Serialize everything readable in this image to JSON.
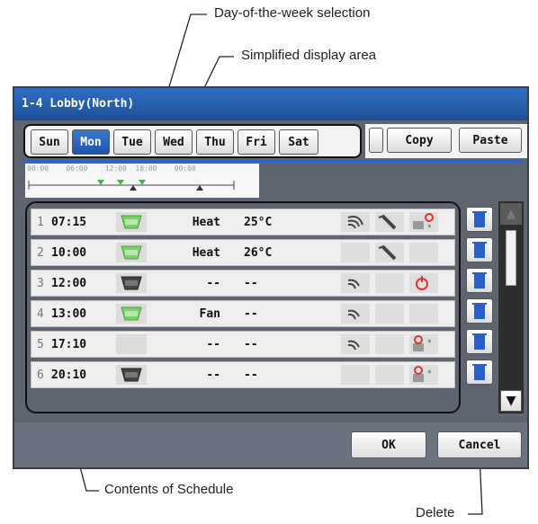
{
  "annotations": {
    "day_selection": "Day-of-the-week selection",
    "simplified_area": "Simplified display area",
    "contents": "Contents of Schedule",
    "delete": "Delete"
  },
  "window": {
    "title": "1-4 Lobby(North)"
  },
  "days": [
    "Sun",
    "Mon",
    "Tue",
    "Wed",
    "Thu",
    "Fri",
    "Sat"
  ],
  "selected_day": "Mon",
  "toolbar": {
    "copy": "Copy",
    "paste": "Paste"
  },
  "simplified": {
    "times": "00:00    06:00    12:00  18:00    00:00"
  },
  "rows": [
    {
      "num": "1",
      "time": "07:15",
      "mode": "Heat",
      "temp": "25°C",
      "icons": [
        "fan-speed-icon",
        "airflow-icon",
        "lock-icon"
      ]
    },
    {
      "num": "2",
      "time": "10:00",
      "mode": "Heat",
      "temp": "26°C",
      "icons": [
        "",
        "airflow-icon",
        ""
      ]
    },
    {
      "num": "3",
      "time": "12:00",
      "mode": "--",
      "temp": "--",
      "icons": [
        "fan-speed-icon",
        "",
        "power-icon"
      ]
    },
    {
      "num": "4",
      "time": "13:00",
      "mode": "Fan",
      "temp": "--",
      "icons": [
        "fan-speed-icon",
        "",
        ""
      ]
    },
    {
      "num": "5",
      "time": "17:10",
      "mode": "--",
      "temp": "--",
      "icons": [
        "fan-speed-icon",
        "",
        "lock-icon"
      ]
    },
    {
      "num": "6",
      "time": "20:10",
      "mode": "--",
      "temp": "--",
      "icons": [
        "",
        "",
        "lock-icon"
      ]
    }
  ],
  "buttons": {
    "ok": "OK",
    "cancel": "Cancel"
  },
  "colors": {
    "accent": "#1f55a8",
    "unit_on": "#7dcf6a",
    "unit_off": "#444444",
    "trash": "#2a5fc4"
  }
}
